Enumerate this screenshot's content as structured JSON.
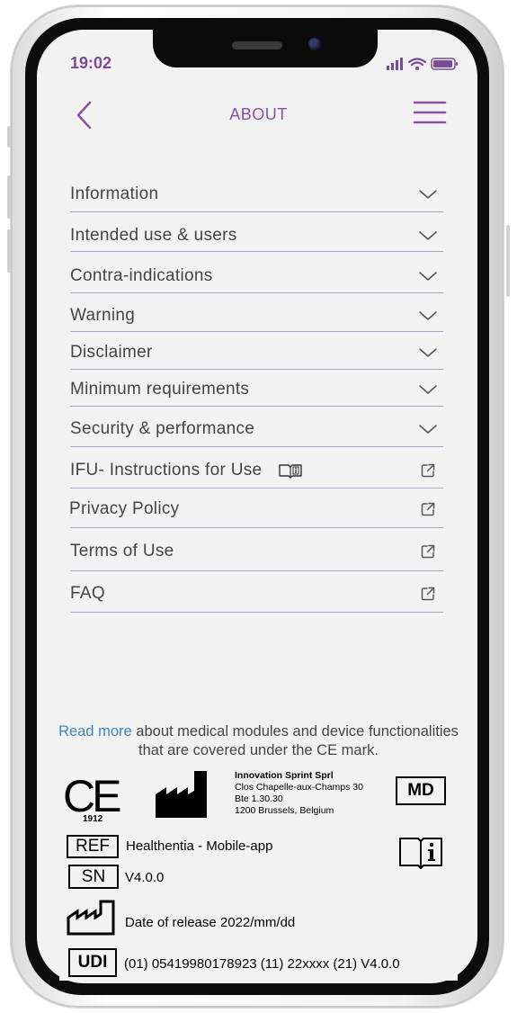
{
  "status_bar": {
    "time": "19:02"
  },
  "header": {
    "title": "ABOUT"
  },
  "menu": {
    "items": [
      {
        "label": "Information",
        "icon": "chevron-down-icon"
      },
      {
        "label": "Intended use & users",
        "icon": "chevron-down-icon"
      },
      {
        "label": "Contra-indications",
        "icon": "chevron-down-icon"
      },
      {
        "label": "Warning",
        "icon": "chevron-down-icon"
      },
      {
        "label": "Disclaimer",
        "icon": "chevron-down-icon"
      },
      {
        "label": "Minimum requirements",
        "icon": "chevron-down-icon"
      },
      {
        "label": "Security & performance",
        "icon": "chevron-down-icon"
      },
      {
        "label": "IFU- Instructions for Use",
        "icon": "external-link-icon"
      },
      {
        "label": "Privacy  Policy",
        "icon": "external-link-icon"
      },
      {
        "label": "Terms of Use",
        "icon": "external-link-icon"
      },
      {
        "label": "FAQ",
        "icon": "external-link-icon"
      }
    ]
  },
  "footer": {
    "read_more_link": "Read more",
    "read_more_text": " about medical modules and device functionalities that are covered under the CE mark."
  },
  "device_label": {
    "ce_mark": "CE",
    "notified_body": "1912",
    "manufacturer": {
      "name": "Innovation Sprint Sprl",
      "address_1": "Clos Chapelle-aux-Champs 30",
      "address_2": "Bte 1.30.30",
      "address_3": "1200 Brussels, Belgium"
    },
    "md_symbol": "MD",
    "ref_symbol": "REF",
    "ref_value": "Healthentia - Mobile-app",
    "sn_symbol": "SN",
    "sn_value": "V4.0.0",
    "release_date": "Date of release 2022/mm/dd",
    "udi_symbol": "UDI",
    "udi_value": "(01) 05419980178923 (11) 22xxxx (21) V4.0.0"
  },
  "colors": {
    "accent": "#8a4fa6",
    "divider": "#b99ec9",
    "link": "#3b86c4",
    "screen_bg": "#f2f2f2"
  }
}
